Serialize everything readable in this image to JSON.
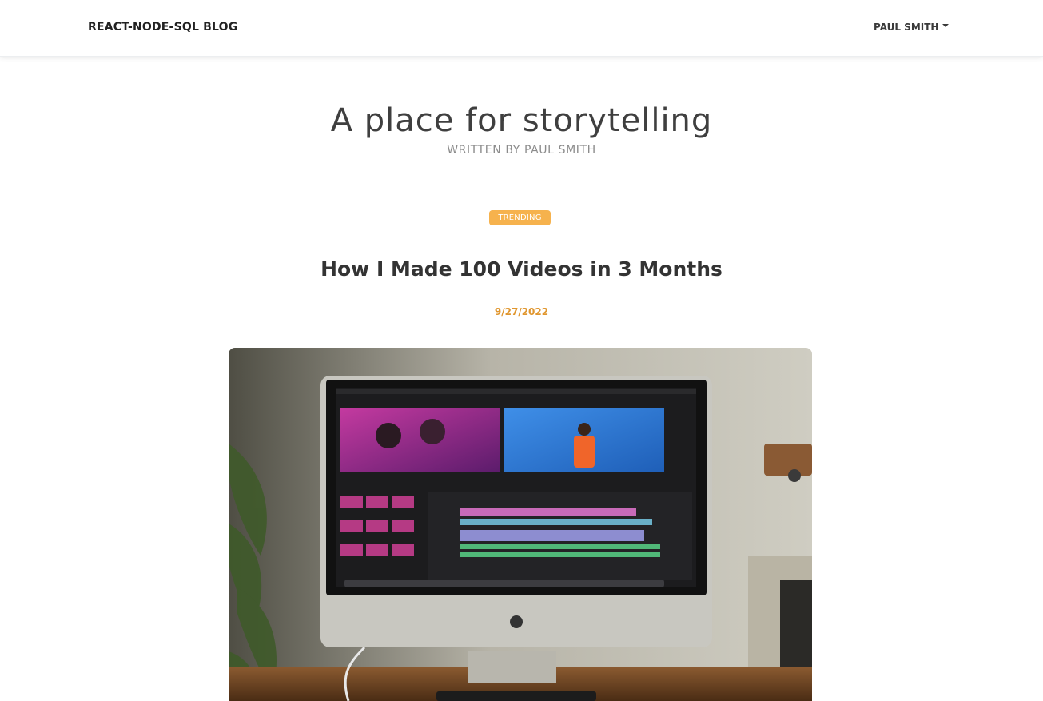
{
  "navbar": {
    "brand": "REACT-NODE-SQL BLOG",
    "user_name": "PAUL SMITH"
  },
  "hero": {
    "title": "A place for storytelling",
    "subtitle": "WRITTEN BY PAUL SMITH"
  },
  "post": {
    "badge": "TRENDING",
    "title": "How I Made 100 Videos in 3 Months",
    "date": "9/27/2022"
  },
  "colors": {
    "badge_bg": "#f6b24d",
    "date_color": "#e0962e",
    "text_dark": "#333333"
  },
  "icons": {
    "user_dropdown": "caret-down-icon"
  }
}
